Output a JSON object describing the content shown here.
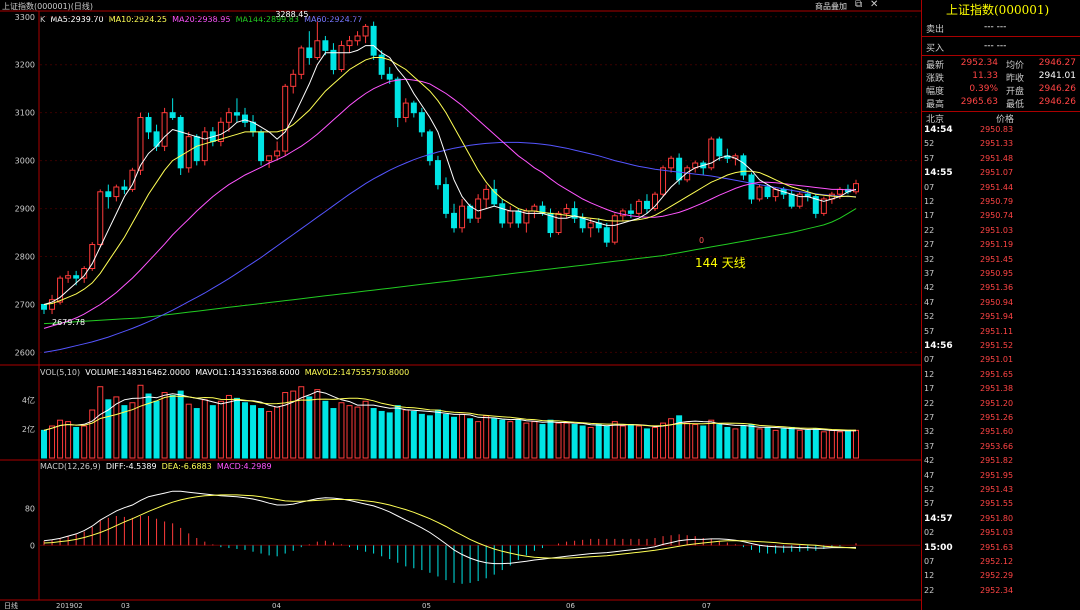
{
  "window": {
    "title": "上证指数(000001)(日线)",
    "toolbar_items": [
      "商品叠加"
    ],
    "icons": [
      "restore-icon",
      "close-icon"
    ]
  },
  "ma_legend": {
    "k": "K",
    "ma5": "MA5:2939.70",
    "ma10": "MA10:2924.25",
    "ma20": "MA20:2938.95",
    "ma144": "MA144:2899.83",
    "ma60": "MA60:2924.77"
  },
  "vol_legend": {
    "vol": "VOL(5,10)",
    "volume": "VOLUME:148316462.0000",
    "mavol1": "MAVOL1:143316368.6000",
    "mavol2": "MAVOL2:147555730.8000"
  },
  "macd_legend": {
    "label": "MACD(12,26,9)",
    "diff": "DIFF:-4.5389",
    "dea": "DEA:-6.6883",
    "macd": "MACD:4.2989"
  },
  "annotations": {
    "high": "3288.45",
    "low": "2679.78",
    "ma144_note": "144 天线",
    "zero_mark": "0"
  },
  "colors": {
    "up": "#ff3b3b",
    "down": "#00e5e5",
    "ma5": "#ffffff",
    "ma10": "#ffff55",
    "ma20": "#ff55ff",
    "ma60": "#5555ff",
    "ma144": "#22cc22",
    "macd_diff": "#ffffff",
    "macd_dea": "#ffff55"
  },
  "chart_data": {
    "type": "candlestick",
    "price_axis": {
      "ticks": [
        "3300",
        "3200",
        "3100",
        "3000",
        "2900",
        "2800",
        "2700",
        "2600"
      ],
      "ylim": [
        2580,
        3310
      ]
    },
    "volume_axis": {
      "ticks": [
        "4亿",
        "2亿"
      ],
      "ylim": [
        0,
        5.5
      ]
    },
    "macd_axis": {
      "ticks": [
        "80",
        "0"
      ],
      "ylim": [
        -115,
        160
      ]
    },
    "date_labels": [
      "日线",
      "201902",
      "03",
      "04",
      "05",
      "06",
      "07"
    ],
    "candles_ohlc": [
      [
        2700,
        2700,
        2680,
        2690
      ],
      [
        2690,
        2720,
        2680,
        2710
      ],
      [
        2705,
        2760,
        2700,
        2755
      ],
      [
        2755,
        2770,
        2745,
        2760
      ],
      [
        2760,
        2770,
        2740,
        2755
      ],
      [
        2755,
        2780,
        2745,
        2775
      ],
      [
        2775,
        2830,
        2770,
        2825
      ],
      [
        2825,
        2940,
        2820,
        2935
      ],
      [
        2935,
        2950,
        2900,
        2925
      ],
      [
        2925,
        2950,
        2915,
        2945
      ],
      [
        2945,
        2960,
        2930,
        2940
      ],
      [
        2940,
        2985,
        2935,
        2980
      ],
      [
        2980,
        3100,
        2970,
        3090
      ],
      [
        3090,
        3100,
        3045,
        3060
      ],
      [
        3060,
        3075,
        3020,
        3030
      ],
      [
        3030,
        3110,
        3020,
        3100
      ],
      [
        3100,
        3130,
        3085,
        3090
      ],
      [
        3090,
        3095,
        2970,
        2985
      ],
      [
        2985,
        3060,
        2975,
        3050
      ],
      [
        3050,
        3055,
        2990,
        3000
      ],
      [
        3000,
        3070,
        2990,
        3060
      ],
      [
        3060,
        3070,
        3030,
        3040
      ],
      [
        3040,
        3090,
        3030,
        3080
      ],
      [
        3080,
        3110,
        3060,
        3100
      ],
      [
        3100,
        3130,
        3080,
        3095
      ],
      [
        3095,
        3110,
        3070,
        3080
      ],
      [
        3080,
        3095,
        3050,
        3060
      ],
      [
        3060,
        3065,
        2990,
        3000
      ],
      [
        3000,
        3010,
        2985,
        3010
      ],
      [
        3010,
        3040,
        3000,
        3020
      ],
      [
        3020,
        3160,
        3010,
        3155
      ],
      [
        3155,
        3190,
        3140,
        3180
      ],
      [
        3180,
        3240,
        3170,
        3235
      ],
      [
        3235,
        3270,
        3200,
        3215
      ],
      [
        3215,
        3290,
        3210,
        3250
      ],
      [
        3250,
        3260,
        3220,
        3230
      ],
      [
        3230,
        3245,
        3180,
        3190
      ],
      [
        3190,
        3250,
        3185,
        3240
      ],
      [
        3240,
        3260,
        3225,
        3250
      ],
      [
        3250,
        3270,
        3240,
        3260
      ],
      [
        3260,
        3285,
        3245,
        3280
      ],
      [
        3280,
        3290,
        3210,
        3220
      ],
      [
        3220,
        3230,
        3170,
        3180
      ],
      [
        3180,
        3195,
        3160,
        3170
      ],
      [
        3170,
        3175,
        3070,
        3090
      ],
      [
        3090,
        3130,
        3080,
        3120
      ],
      [
        3120,
        3125,
        3090,
        3100
      ],
      [
        3100,
        3110,
        3050,
        3060
      ],
      [
        3060,
        3065,
        2990,
        3000
      ],
      [
        3000,
        3010,
        2940,
        2950
      ],
      [
        2950,
        2965,
        2880,
        2890
      ],
      [
        2890,
        2910,
        2850,
        2860
      ],
      [
        2860,
        2920,
        2850,
        2905
      ],
      [
        2905,
        2910,
        2870,
        2880
      ],
      [
        2880,
        2930,
        2870,
        2920
      ],
      [
        2920,
        2950,
        2900,
        2940
      ],
      [
        2940,
        2960,
        2905,
        2910
      ],
      [
        2910,
        2920,
        2860,
        2870
      ],
      [
        2870,
        2905,
        2860,
        2895
      ],
      [
        2895,
        2900,
        2860,
        2870
      ],
      [
        2870,
        2900,
        2850,
        2895
      ],
      [
        2895,
        2910,
        2880,
        2905
      ],
      [
        2905,
        2915,
        2885,
        2890
      ],
      [
        2890,
        2900,
        2840,
        2850
      ],
      [
        2850,
        2895,
        2845,
        2890
      ],
      [
        2890,
        2910,
        2880,
        2900
      ],
      [
        2900,
        2915,
        2870,
        2880
      ],
      [
        2880,
        2890,
        2850,
        2860
      ],
      [
        2860,
        2880,
        2840,
        2870
      ],
      [
        2870,
        2880,
        2850,
        2860
      ],
      [
        2860,
        2870,
        2820,
        2830
      ],
      [
        2830,
        2890,
        2825,
        2885
      ],
      [
        2885,
        2900,
        2875,
        2895
      ],
      [
        2895,
        2910,
        2880,
        2890
      ],
      [
        2890,
        2920,
        2885,
        2915
      ],
      [
        2915,
        2930,
        2890,
        2900
      ],
      [
        2900,
        2935,
        2895,
        2930
      ],
      [
        2930,
        2990,
        2925,
        2985
      ],
      [
        2985,
        3010,
        2975,
        3005
      ],
      [
        3005,
        3015,
        2950,
        2960
      ],
      [
        2960,
        2990,
        2955,
        2985
      ],
      [
        2985,
        3000,
        2975,
        2995
      ],
      [
        2995,
        3000,
        2970,
        2985
      ],
      [
        2985,
        3050,
        2980,
        3045
      ],
      [
        3045,
        3050,
        3000,
        3010
      ],
      [
        3010,
        3025,
        2995,
        3005
      ],
      [
        3005,
        3015,
        2990,
        3010
      ],
      [
        3010,
        3015,
        2960,
        2970
      ],
      [
        2970,
        2975,
        2910,
        2920
      ],
      [
        2920,
        2950,
        2915,
        2945
      ],
      [
        2945,
        2950,
        2920,
        2925
      ],
      [
        2925,
        2945,
        2915,
        2940
      ],
      [
        2940,
        2945,
        2920,
        2930
      ],
      [
        2930,
        2940,
        2900,
        2905
      ],
      [
        2905,
        2935,
        2900,
        2930
      ],
      [
        2930,
        2940,
        2915,
        2925
      ],
      [
        2925,
        2930,
        2880,
        2890
      ],
      [
        2890,
        2925,
        2885,
        2920
      ],
      [
        2920,
        2935,
        2910,
        2930
      ],
      [
        2930,
        2945,
        2920,
        2940
      ],
      [
        2940,
        2950,
        2930,
        2935
      ],
      [
        2935,
        2960,
        2930,
        2952
      ]
    ],
    "ma_lines": {
      "ma5": [
        2700,
        2705,
        2715,
        2730,
        2745,
        2760,
        2785,
        2820,
        2855,
        2890,
        2925,
        2950,
        2990,
        3015,
        3030,
        3050,
        3065,
        3060,
        3055,
        3050,
        3045,
        3050,
        3055,
        3065,
        3080,
        3085,
        3080,
        3070,
        3060,
        3045,
        3060,
        3090,
        3125,
        3160,
        3200,
        3225,
        3225,
        3225,
        3225,
        3230,
        3240,
        3240,
        3225,
        3215,
        3190,
        3170,
        3140,
        3115,
        3090,
        3060,
        3010,
        2960,
        2925,
        2905,
        2895,
        2900,
        2905,
        2900,
        2895,
        2895,
        2890,
        2890,
        2890,
        2885,
        2880,
        2880,
        2885,
        2880,
        2875,
        2870,
        2865,
        2865,
        2870,
        2875,
        2880,
        2890,
        2905,
        2925,
        2945,
        2960,
        2975,
        2985,
        2990,
        2995,
        3005,
        3010,
        3005,
        2995,
        2980,
        2960,
        2950,
        2940,
        2935,
        2930,
        2925,
        2925,
        2920,
        2915,
        2920,
        2925,
        2935,
        2940
      ],
      "ma10": [
        2700,
        2702,
        2708,
        2715,
        2722,
        2732,
        2745,
        2765,
        2790,
        2815,
        2840,
        2870,
        2900,
        2930,
        2955,
        2980,
        3000,
        3010,
        3020,
        3030,
        3035,
        3040,
        3045,
        3050,
        3055,
        3060,
        3060,
        3060,
        3060,
        3060,
        3065,
        3075,
        3090,
        3105,
        3125,
        3145,
        3160,
        3175,
        3190,
        3200,
        3210,
        3215,
        3215,
        3210,
        3200,
        3190,
        3175,
        3160,
        3145,
        3125,
        3100,
        3070,
        3040,
        3010,
        2980,
        2955,
        2935,
        2920,
        2910,
        2900,
        2895,
        2895,
        2892,
        2890,
        2888,
        2886,
        2884,
        2882,
        2880,
        2878,
        2875,
        2874,
        2874,
        2875,
        2877,
        2880,
        2886,
        2895,
        2905,
        2915,
        2925,
        2935,
        2945,
        2955,
        2962,
        2970,
        2975,
        2978,
        2978,
        2975,
        2968,
        2960,
        2952,
        2945,
        2940,
        2935,
        2930,
        2928,
        2926,
        2925,
        2926,
        2924
      ],
      "ma20": [
        2650,
        2655,
        2660,
        2665,
        2672,
        2680,
        2690,
        2700,
        2712,
        2725,
        2740,
        2755,
        2772,
        2790,
        2808,
        2826,
        2845,
        2862,
        2878,
        2895,
        2910,
        2925,
        2938,
        2950,
        2960,
        2970,
        2978,
        2986,
        2995,
        3002,
        3010,
        3020,
        3030,
        3042,
        3055,
        3070,
        3085,
        3100,
        3115,
        3128,
        3140,
        3150,
        3158,
        3165,
        3168,
        3170,
        3168,
        3165,
        3160,
        3150,
        3140,
        3128,
        3115,
        3100,
        3085,
        3070,
        3055,
        3040,
        3025,
        3010,
        2998,
        2985,
        2975,
        2962,
        2950,
        2940,
        2930,
        2920,
        2912,
        2905,
        2898,
        2892,
        2888,
        2885,
        2883,
        2882,
        2882,
        2884,
        2888,
        2892,
        2898,
        2905,
        2912,
        2920,
        2928,
        2935,
        2942,
        2948,
        2952,
        2955,
        2955,
        2954,
        2952,
        2950,
        2948,
        2946,
        2944,
        2942,
        2940,
        2940,
        2939,
        2939
      ],
      "ma60": [
        2600,
        2603,
        2606,
        2610,
        2614,
        2618,
        2622,
        2627,
        2632,
        2638,
        2644,
        2650,
        2657,
        2664,
        2672,
        2680,
        2688,
        2697,
        2706,
        2715,
        2724,
        2734,
        2744,
        2754,
        2765,
        2776,
        2787,
        2798,
        2810,
        2822,
        2834,
        2846,
        2858,
        2870,
        2882,
        2894,
        2906,
        2918,
        2930,
        2941,
        2952,
        2962,
        2971,
        2980,
        2988,
        2995,
        3002,
        3008,
        3013,
        3018,
        3022,
        3026,
        3029,
        3032,
        3034,
        3036,
        3037,
        3038,
        3038,
        3038,
        3037,
        3036,
        3034,
        3032,
        3029,
        3026,
        3022,
        3018,
        3014,
        3010,
        3005,
        3000,
        2996,
        2992,
        2988,
        2985,
        2982,
        2980,
        2978,
        2976,
        2974,
        2972,
        2970,
        2968,
        2965,
        2962,
        2959,
        2956,
        2953,
        2950,
        2947,
        2944,
        2941,
        2938,
        2935,
        2933,
        2931,
        2929,
        2927,
        2926,
        2925,
        2925
      ],
      "ma144": [
        2660,
        2661,
        2662,
        2663,
        2664,
        2665,
        2666,
        2667,
        2668,
        2669,
        2670,
        2671,
        2672,
        2674,
        2676,
        2678,
        2680,
        2682,
        2684,
        2686,
        2688,
        2690,
        2692,
        2694,
        2696,
        2698,
        2700,
        2702,
        2704,
        2706,
        2708,
        2710,
        2712,
        2714,
        2716,
        2718,
        2720,
        2722,
        2724,
        2726,
        2728,
        2730,
        2732,
        2734,
        2736,
        2738,
        2740,
        2742,
        2744,
        2746,
        2748,
        2750,
        2752,
        2754,
        2756,
        2758,
        2760,
        2762,
        2764,
        2766,
        2768,
        2770,
        2772,
        2774,
        2776,
        2778,
        2780,
        2782,
        2784,
        2786,
        2788,
        2790,
        2792,
        2794,
        2796,
        2798,
        2800,
        2802,
        2805,
        2808,
        2811,
        2814,
        2817,
        2820,
        2823,
        2826,
        2829,
        2832,
        2835,
        2838,
        2841,
        2844,
        2847,
        2850,
        2854,
        2858,
        2862,
        2866,
        2872,
        2880,
        2890,
        2900
      ]
    },
    "volume_values": [
      1.9,
      2.2,
      2.6,
      2.5,
      2.1,
      2.2,
      3.3,
      4.9,
      4.0,
      4.2,
      3.6,
      3.8,
      5.0,
      4.4,
      3.9,
      4.5,
      4.3,
      4.6,
      3.7,
      3.4,
      4.0,
      3.6,
      3.9,
      4.3,
      4.1,
      3.8,
      3.6,
      3.4,
      3.2,
      3.5,
      4.5,
      4.6,
      4.9,
      4.2,
      4.7,
      3.9,
      3.4,
      3.8,
      3.6,
      3.5,
      3.9,
      3.4,
      3.2,
      3.1,
      3.6,
      3.3,
      3.2,
      3.0,
      2.9,
      3.3,
      3.0,
      2.8,
      3.0,
      2.7,
      2.5,
      2.9,
      2.7,
      2.6,
      2.5,
      2.6,
      2.4,
      2.5,
      2.3,
      2.6,
      2.4,
      2.4,
      2.3,
      2.2,
      2.1,
      2.3,
      2.2,
      2.5,
      2.2,
      2.3,
      2.2,
      2.0,
      2.1,
      2.4,
      2.7,
      2.9,
      2.4,
      2.3,
      2.2,
      2.6,
      2.3,
      2.1,
      2.0,
      2.2,
      2.3,
      2.0,
      2.1,
      1.9,
      2.0,
      2.1,
      1.9,
      1.9,
      2.0,
      1.8,
      1.9,
      1.8,
      1.9,
      1.9
    ],
    "macd_diff": [
      10,
      12,
      15,
      20,
      25,
      32,
      42,
      55,
      65,
      75,
      82,
      88,
      98,
      106,
      110,
      114,
      118,
      118,
      116,
      114,
      112,
      110,
      108,
      107,
      106,
      104,
      101,
      97,
      92,
      88,
      88,
      90,
      94,
      98,
      102,
      104,
      103,
      101,
      98,
      94,
      90,
      86,
      80,
      73,
      64,
      55,
      47,
      38,
      28,
      16,
      3,
      -10,
      -20,
      -28,
      -34,
      -38,
      -40,
      -40,
      -39,
      -37,
      -35,
      -32,
      -30,
      -28,
      -26,
      -24,
      -22,
      -20,
      -18,
      -17,
      -16,
      -14,
      -12,
      -10,
      -8,
      -6,
      -3,
      2,
      6,
      10,
      12,
      13,
      13,
      14,
      14,
      13,
      11,
      8,
      4,
      0,
      -2,
      -3,
      -4,
      -4,
      -5,
      -5,
      -6,
      -6,
      -5,
      -5,
      -5,
      -4.5
    ],
    "macd_dea": [
      5,
      6,
      8,
      10,
      13,
      17,
      22,
      28,
      35,
      43,
      51,
      58,
      66,
      74,
      81,
      88,
      94,
      99,
      103,
      106,
      108,
      109,
      110,
      110,
      110,
      109,
      108,
      106,
      103,
      100,
      97,
      96,
      96,
      97,
      98,
      99,
      100,
      100,
      100,
      99,
      97,
      95,
      92,
      88,
      83,
      78,
      72,
      65,
      58,
      50,
      41,
      31,
      22,
      13,
      5,
      -2,
      -8,
      -13,
      -17,
      -21,
      -24,
      -26,
      -27,
      -28,
      -28,
      -28,
      -27,
      -26,
      -25,
      -24,
      -23,
      -21,
      -19,
      -17,
      -15,
      -13,
      -11,
      -8,
      -5,
      -2,
      1,
      3,
      5,
      7,
      9,
      10,
      10,
      10,
      9,
      8,
      7,
      6,
      4,
      3,
      2,
      1,
      0,
      -2,
      -3,
      -4,
      -5,
      -6.7
    ]
  }
}
